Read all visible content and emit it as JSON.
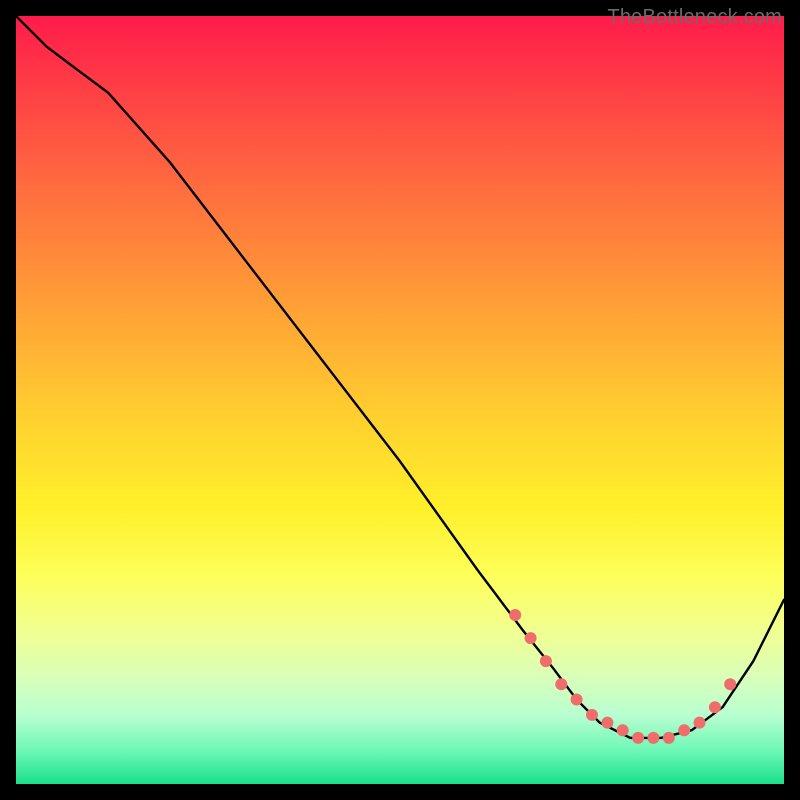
{
  "watermark": "TheBottleneck.com",
  "chart_data": {
    "type": "line",
    "title": "",
    "xlabel": "",
    "ylabel": "",
    "xlim": [
      0,
      100
    ],
    "ylim": [
      0,
      100
    ],
    "grid": false,
    "legend": false,
    "background": "rainbow-vertical-gradient",
    "background_stops": [
      {
        "pos": 0,
        "color": "#ff1b4a"
      },
      {
        "pos": 8,
        "color": "#ff3946"
      },
      {
        "pos": 22,
        "color": "#ff6b3f"
      },
      {
        "pos": 36,
        "color": "#ff9a37"
      },
      {
        "pos": 52,
        "color": "#ffcf2f"
      },
      {
        "pos": 64,
        "color": "#fff02a"
      },
      {
        "pos": 73,
        "color": "#fdff5a"
      },
      {
        "pos": 80,
        "color": "#f1ff91"
      },
      {
        "pos": 86,
        "color": "#d9ffb8"
      },
      {
        "pos": 91,
        "color": "#b9ffd1"
      },
      {
        "pos": 96,
        "color": "#67f6b3"
      },
      {
        "pos": 100,
        "color": "#18e08a"
      }
    ],
    "series": [
      {
        "name": "curve",
        "color": "#000000",
        "x": [
          0,
          4,
          8,
          12,
          20,
          30,
          40,
          50,
          60,
          66,
          70,
          73,
          76,
          80,
          84,
          88,
          92,
          96,
          100
        ],
        "y": [
          100,
          96,
          93,
          90,
          81,
          68,
          55,
          42,
          28,
          20,
          15,
          11,
          8,
          6,
          6,
          7,
          10,
          16,
          24
        ]
      }
    ],
    "markers": {
      "name": "dotted-region",
      "color": "#ef6d6b",
      "radius_px": 6,
      "x": [
        65,
        67,
        69,
        71,
        73,
        75,
        77,
        79,
        81,
        83,
        85,
        87,
        89,
        91,
        93
      ],
      "y": [
        22,
        19,
        16,
        13,
        11,
        9,
        8,
        7,
        6,
        6,
        6,
        7,
        8,
        10,
        13
      ]
    }
  }
}
